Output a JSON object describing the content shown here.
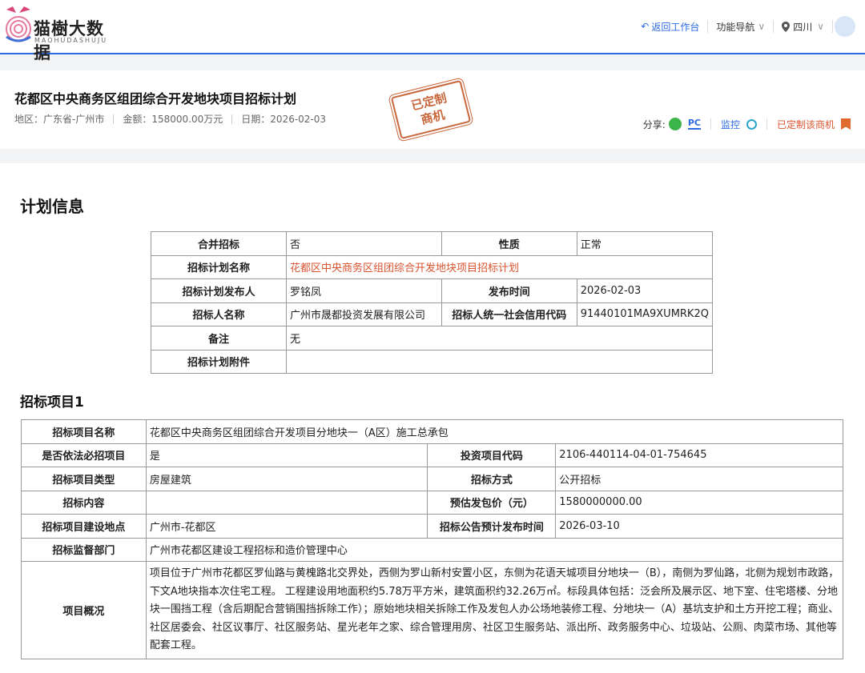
{
  "header": {
    "logo_text": "猫樹大数据",
    "logo_sub": "MAOHUDASHUJU",
    "nav": {
      "back": "返回工作台",
      "menu": "功能导航",
      "region": "四川"
    }
  },
  "project": {
    "title": "花都区中央商务区组团综合开发地块项目招标计划",
    "region_label": "地区：",
    "region": "广东省-广州市",
    "amount_label": "金额：",
    "amount": "158000.00万元",
    "date_label": "日期：",
    "date": "2026-02-03",
    "stamp_line1": "已定制",
    "stamp_line2": "商机",
    "share_label": "分享:",
    "pc_label": "PC",
    "monitor_label": "监控",
    "custom_label": "已定制该商机"
  },
  "plan_section": {
    "title": "计划信息",
    "merge_label": "合并招标",
    "merge_value": "否",
    "nature_label": "性质",
    "nature_value": "正常",
    "plan_name_label": "招标计划名称",
    "plan_name_value": "花都区中央商务区组团综合开发地块项目招标计划",
    "publisher_label": "招标计划发布人",
    "publisher_value": "罗铭凤",
    "pub_time_label": "发布时间",
    "pub_time_value": "2026-02-03",
    "tenderer_label": "招标人名称",
    "tenderer_value": "广州市晟都投资发展有限公司",
    "credit_label": "招标人统一社会信用代码",
    "credit_value": "91440101MA9XUMRK2Q",
    "remark_label": "备注",
    "remark_value": "无",
    "attachment_label": "招标计划附件",
    "attachment_value": ""
  },
  "item_section": {
    "title": "招标项目1",
    "name_label": "招标项目名称",
    "name_value": "花都区中央商务区组团综合开发项目分地块一（A区）施工总承包",
    "mandatory_label": "是否依法必招项目",
    "mandatory_value": "是",
    "invest_code_label": "投资项目代码",
    "invest_code_value": "2106-440114-04-01-754645",
    "type_label": "招标项目类型",
    "type_value": "房屋建筑",
    "method_label": "招标方式",
    "method_value": "公开招标",
    "content_label": "招标内容",
    "content_value": "",
    "price_label": "预估发包价（元）",
    "price_value": "1580000000.00",
    "location_label": "招标项目建设地点",
    "location_value": "广州市-花都区",
    "notice_time_label": "招标公告预计发布时间",
    "notice_time_value": "2026-03-10",
    "dept_label": "招标监督部门",
    "dept_value": "广州市花都区建设工程招标和造价管理中心",
    "overview_label": "项目概况",
    "overview_value": "项目位于广州市花都区罗仙路与黄槐路北交界处，西侧为罗山新村安置小区，东侧为花语天城项目分地块一（B），南侧为罗仙路，北侧为规划市政路，下文A地块指本次住宅工程。 工程建设用地面积约5.78万平方米，建筑面积约32.26万㎡。标段具体包括：泛会所及展示区、地下室、住宅塔楼、分地块一围挡工程（含后期配合营销围挡拆除工作）；原始地块相关拆除工作及发包人办公场地装修工程、分地块一（A）基坑支护和土方开挖工程；商业、社区居委会、社区议事厅、社区服务站、星光老年之家、综合管理用房、社区卫生服务站、派出所、政务服务中心、垃圾站、公厕、肉菜市场、其他等配套工程。"
  }
}
